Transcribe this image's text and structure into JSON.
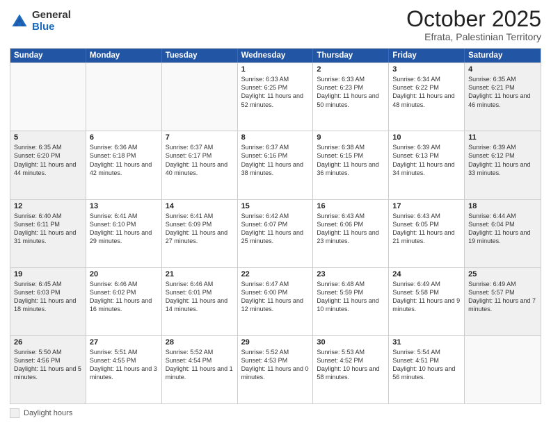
{
  "logo": {
    "general": "General",
    "blue": "Blue"
  },
  "title": "October 2025",
  "subtitle": "Efrata, Palestinian Territory",
  "weekdays": [
    "Sunday",
    "Monday",
    "Tuesday",
    "Wednesday",
    "Thursday",
    "Friday",
    "Saturday"
  ],
  "weeks": [
    [
      {
        "day": "",
        "info": "",
        "empty": true
      },
      {
        "day": "",
        "info": "",
        "empty": true
      },
      {
        "day": "",
        "info": "",
        "empty": true
      },
      {
        "day": "1",
        "info": "Sunrise: 6:33 AM\nSunset: 6:25 PM\nDaylight: 11 hours\nand 52 minutes.",
        "empty": false
      },
      {
        "day": "2",
        "info": "Sunrise: 6:33 AM\nSunset: 6:23 PM\nDaylight: 11 hours\nand 50 minutes.",
        "empty": false
      },
      {
        "day": "3",
        "info": "Sunrise: 6:34 AM\nSunset: 6:22 PM\nDaylight: 11 hours\nand 48 minutes.",
        "empty": false
      },
      {
        "day": "4",
        "info": "Sunrise: 6:35 AM\nSunset: 6:21 PM\nDaylight: 11 hours\nand 46 minutes.",
        "empty": false,
        "shaded": true
      }
    ],
    [
      {
        "day": "5",
        "info": "Sunrise: 6:35 AM\nSunset: 6:20 PM\nDaylight: 11 hours\nand 44 minutes.",
        "empty": false,
        "shaded": true
      },
      {
        "day": "6",
        "info": "Sunrise: 6:36 AM\nSunset: 6:18 PM\nDaylight: 11 hours\nand 42 minutes.",
        "empty": false
      },
      {
        "day": "7",
        "info": "Sunrise: 6:37 AM\nSunset: 6:17 PM\nDaylight: 11 hours\nand 40 minutes.",
        "empty": false
      },
      {
        "day": "8",
        "info": "Sunrise: 6:37 AM\nSunset: 6:16 PM\nDaylight: 11 hours\nand 38 minutes.",
        "empty": false
      },
      {
        "day": "9",
        "info": "Sunrise: 6:38 AM\nSunset: 6:15 PM\nDaylight: 11 hours\nand 36 minutes.",
        "empty": false
      },
      {
        "day": "10",
        "info": "Sunrise: 6:39 AM\nSunset: 6:13 PM\nDaylight: 11 hours\nand 34 minutes.",
        "empty": false
      },
      {
        "day": "11",
        "info": "Sunrise: 6:39 AM\nSunset: 6:12 PM\nDaylight: 11 hours\nand 33 minutes.",
        "empty": false,
        "shaded": true
      }
    ],
    [
      {
        "day": "12",
        "info": "Sunrise: 6:40 AM\nSunset: 6:11 PM\nDaylight: 11 hours\nand 31 minutes.",
        "empty": false,
        "shaded": true
      },
      {
        "day": "13",
        "info": "Sunrise: 6:41 AM\nSunset: 6:10 PM\nDaylight: 11 hours\nand 29 minutes.",
        "empty": false
      },
      {
        "day": "14",
        "info": "Sunrise: 6:41 AM\nSunset: 6:09 PM\nDaylight: 11 hours\nand 27 minutes.",
        "empty": false
      },
      {
        "day": "15",
        "info": "Sunrise: 6:42 AM\nSunset: 6:07 PM\nDaylight: 11 hours\nand 25 minutes.",
        "empty": false
      },
      {
        "day": "16",
        "info": "Sunrise: 6:43 AM\nSunset: 6:06 PM\nDaylight: 11 hours\nand 23 minutes.",
        "empty": false
      },
      {
        "day": "17",
        "info": "Sunrise: 6:43 AM\nSunset: 6:05 PM\nDaylight: 11 hours\nand 21 minutes.",
        "empty": false
      },
      {
        "day": "18",
        "info": "Sunrise: 6:44 AM\nSunset: 6:04 PM\nDaylight: 11 hours\nand 19 minutes.",
        "empty": false,
        "shaded": true
      }
    ],
    [
      {
        "day": "19",
        "info": "Sunrise: 6:45 AM\nSunset: 6:03 PM\nDaylight: 11 hours\nand 18 minutes.",
        "empty": false,
        "shaded": true
      },
      {
        "day": "20",
        "info": "Sunrise: 6:46 AM\nSunset: 6:02 PM\nDaylight: 11 hours\nand 16 minutes.",
        "empty": false
      },
      {
        "day": "21",
        "info": "Sunrise: 6:46 AM\nSunset: 6:01 PM\nDaylight: 11 hours\nand 14 minutes.",
        "empty": false
      },
      {
        "day": "22",
        "info": "Sunrise: 6:47 AM\nSunset: 6:00 PM\nDaylight: 11 hours\nand 12 minutes.",
        "empty": false
      },
      {
        "day": "23",
        "info": "Sunrise: 6:48 AM\nSunset: 5:59 PM\nDaylight: 11 hours\nand 10 minutes.",
        "empty": false
      },
      {
        "day": "24",
        "info": "Sunrise: 6:49 AM\nSunset: 5:58 PM\nDaylight: 11 hours\nand 9 minutes.",
        "empty": false
      },
      {
        "day": "25",
        "info": "Sunrise: 6:49 AM\nSunset: 5:57 PM\nDaylight: 11 hours\nand 7 minutes.",
        "empty": false,
        "shaded": true
      }
    ],
    [
      {
        "day": "26",
        "info": "Sunrise: 5:50 AM\nSunset: 4:56 PM\nDaylight: 11 hours\nand 5 minutes.",
        "empty": false,
        "shaded": true
      },
      {
        "day": "27",
        "info": "Sunrise: 5:51 AM\nSunset: 4:55 PM\nDaylight: 11 hours\nand 3 minutes.",
        "empty": false
      },
      {
        "day": "28",
        "info": "Sunrise: 5:52 AM\nSunset: 4:54 PM\nDaylight: 11 hours\nand 1 minute.",
        "empty": false
      },
      {
        "day": "29",
        "info": "Sunrise: 5:52 AM\nSunset: 4:53 PM\nDaylight: 11 hours\nand 0 minutes.",
        "empty": false
      },
      {
        "day": "30",
        "info": "Sunrise: 5:53 AM\nSunset: 4:52 PM\nDaylight: 10 hours\nand 58 minutes.",
        "empty": false
      },
      {
        "day": "31",
        "info": "Sunrise: 5:54 AM\nSunset: 4:51 PM\nDaylight: 10 hours\nand 56 minutes.",
        "empty": false
      },
      {
        "day": "",
        "info": "",
        "empty": true
      }
    ]
  ],
  "legend": {
    "label": "Daylight hours"
  }
}
